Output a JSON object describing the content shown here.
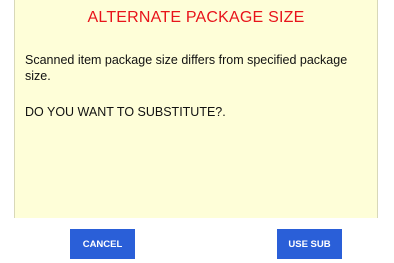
{
  "dialog": {
    "title": "ALTERNATE PACKAGE SIZE",
    "message": "Scanned item package size differs from specified package size.",
    "prompt": "DO YOU WANT TO SUBSTITUTE?.",
    "colors": {
      "background": "#fefed8",
      "title": "#e8141b",
      "button": "#2a5fd8"
    }
  },
  "buttons": {
    "cancel_label": "CANCEL",
    "use_sub_label": "USE SUB"
  }
}
